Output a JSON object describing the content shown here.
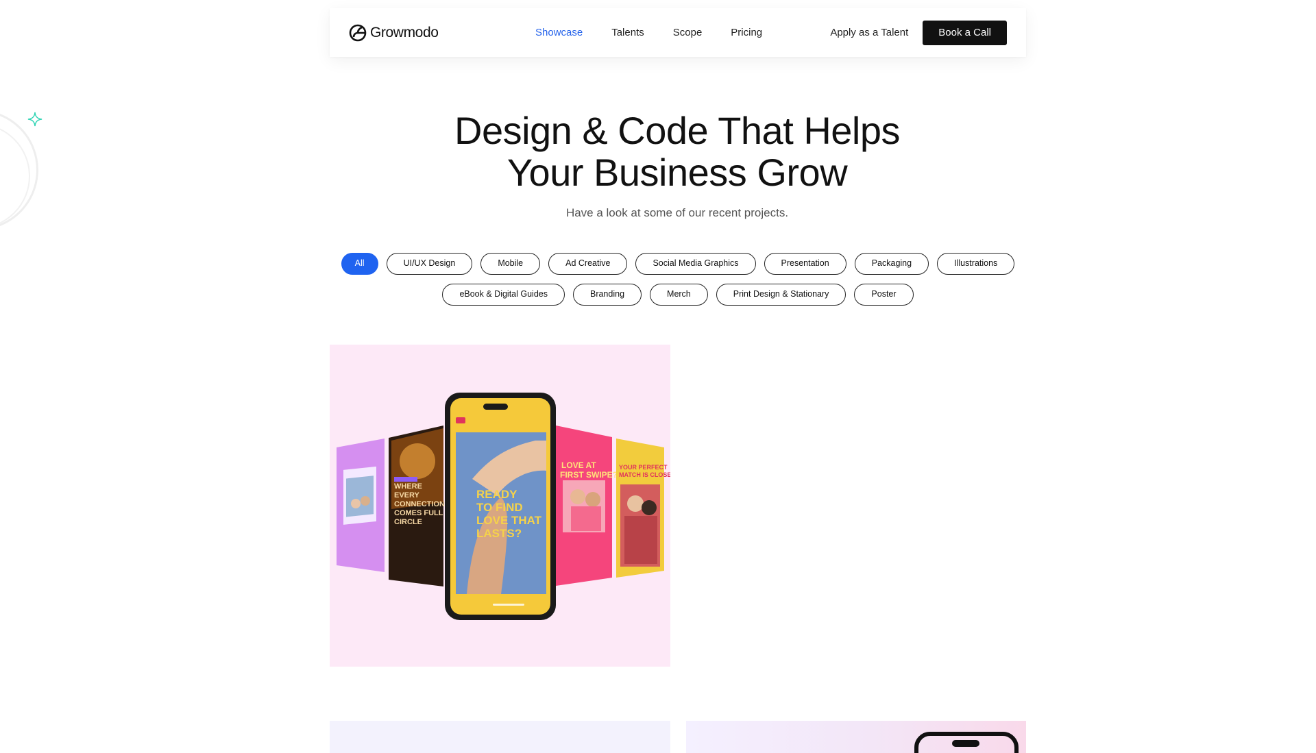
{
  "brand": {
    "name": "Growmodo"
  },
  "nav": {
    "links": [
      {
        "label": "Showcase",
        "active": true
      },
      {
        "label": "Talents",
        "active": false
      },
      {
        "label": "Scope",
        "active": false
      },
      {
        "label": "Pricing",
        "active": false
      }
    ],
    "apply_label": "Apply as a Talent",
    "cta_label": "Book a Call"
  },
  "hero": {
    "title_line1": "Design & Code That Helps",
    "title_line2": "Your Business Grow",
    "subtitle": "Have a look at some of our recent projects."
  },
  "filters": {
    "row1": [
      "All",
      "UI/UX Design",
      "Mobile",
      "Ad Creative",
      "Social Media Graphics",
      "Presentation",
      "Packaging",
      "Illustrations"
    ],
    "row2": [
      "eBook & Digital Guides",
      "Branding",
      "Merch",
      "Print Design & Stationary",
      "Poster"
    ],
    "selected": "All"
  },
  "projects": {
    "card1": {
      "phone_text": "READY TO FIND LOVE THAT LASTS?",
      "panel_left_text": "WHERE EVERY CONNECTION COMES FULL CIRCLE",
      "panel_right_text": "LOVE AT FIRST SWIPE?",
      "panel_far_right_text": "YOUR PERFECT MATCH IS CLOSE"
    }
  },
  "colors": {
    "accent": "#1f63f0",
    "active_nav": "#2563eb",
    "sparkle": "#2fd4b4",
    "card1_bg": "#fde9f7",
    "phone_screen": "#f5c93a"
  },
  "icons": {
    "logo": "growmodo-logo-icon",
    "sparkle": "sparkle-icon"
  }
}
